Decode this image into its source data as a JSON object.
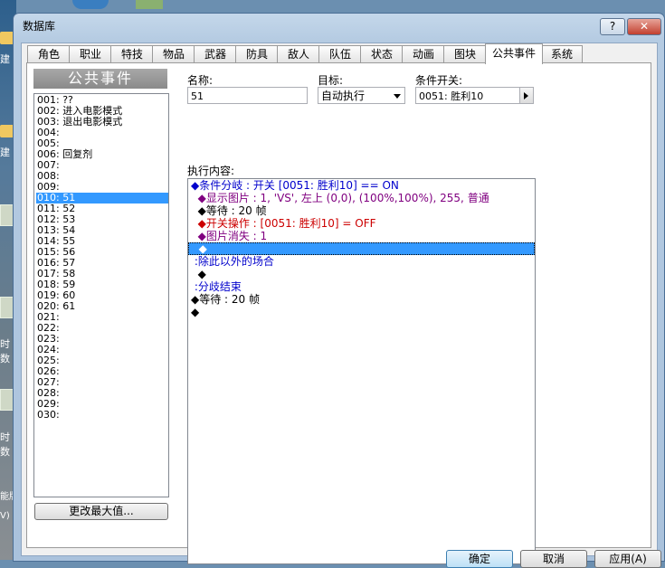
{
  "window": {
    "title": "数据库",
    "help_label": "?",
    "close_label": "✕"
  },
  "desktop": {
    "labels": [
      "建",
      "建",
      "时",
      "数",
      "时",
      "数",
      "能版",
      "V)"
    ]
  },
  "tabs": [
    {
      "label": "角色"
    },
    {
      "label": "职业"
    },
    {
      "label": "特技"
    },
    {
      "label": "物品"
    },
    {
      "label": "武器"
    },
    {
      "label": "防具"
    },
    {
      "label": "敌人"
    },
    {
      "label": "队伍"
    },
    {
      "label": "状态"
    },
    {
      "label": "动画"
    },
    {
      "label": "图块"
    },
    {
      "label": "公共事件"
    },
    {
      "label": "系统"
    }
  ],
  "event_list": {
    "title": "公共事件",
    "items": [
      "001: ??",
      "002: 进入电影模式",
      "003: 退出电影模式",
      "004:",
      "005:",
      "006: 回复剂",
      "007:",
      "008:",
      "009:",
      "010: 51",
      "011: 52",
      "012: 53",
      "013: 54",
      "014: 55",
      "015: 56",
      "016: 57",
      "017: 58",
      "018: 59",
      "019: 60",
      "020: 61",
      "021:",
      "022:",
      "023:",
      "024:",
      "025:",
      "026:",
      "027:",
      "028:",
      "029:",
      "030:"
    ],
    "selected_index": 9,
    "change_max_label": "更改最大值..."
  },
  "form": {
    "name_label": "名称:",
    "name_value": "51",
    "target_label": "目标:",
    "target_value": "自动执行",
    "switch_label": "条件开关:",
    "switch_value": "0051: 胜利10",
    "content_label": "执行内容:"
  },
  "commands": [
    {
      "text": "◆条件分岐 : 开关 [0051: 胜利10] == ON",
      "color": "blue"
    },
    {
      "text": "  ◆显示图片 : 1, 'VS', 左上 (0,0), (100%,100%), 255, 普通",
      "color": "purple"
    },
    {
      "text": "  ◆等待 : 20 帧",
      "color": "black"
    },
    {
      "text": "  ◆开关操作 : [0051: 胜利10] = OFF",
      "color": "red"
    },
    {
      "text": "  ◆图片消失 : 1",
      "color": "purple"
    },
    {
      "text": "  ◆",
      "color": "sel-mark",
      "selected": true
    },
    {
      "text": " :除此以外的场合",
      "color": "blue"
    },
    {
      "text": "  ◆",
      "color": "black"
    },
    {
      "text": " :分歧结束",
      "color": "blue"
    },
    {
      "text": "◆等待 : 20 帧",
      "color": "black"
    },
    {
      "text": "◆",
      "color": "black"
    }
  ],
  "buttons": {
    "ok_label": "确定",
    "cancel_label": "取消",
    "apply_label": "应用(A)"
  }
}
